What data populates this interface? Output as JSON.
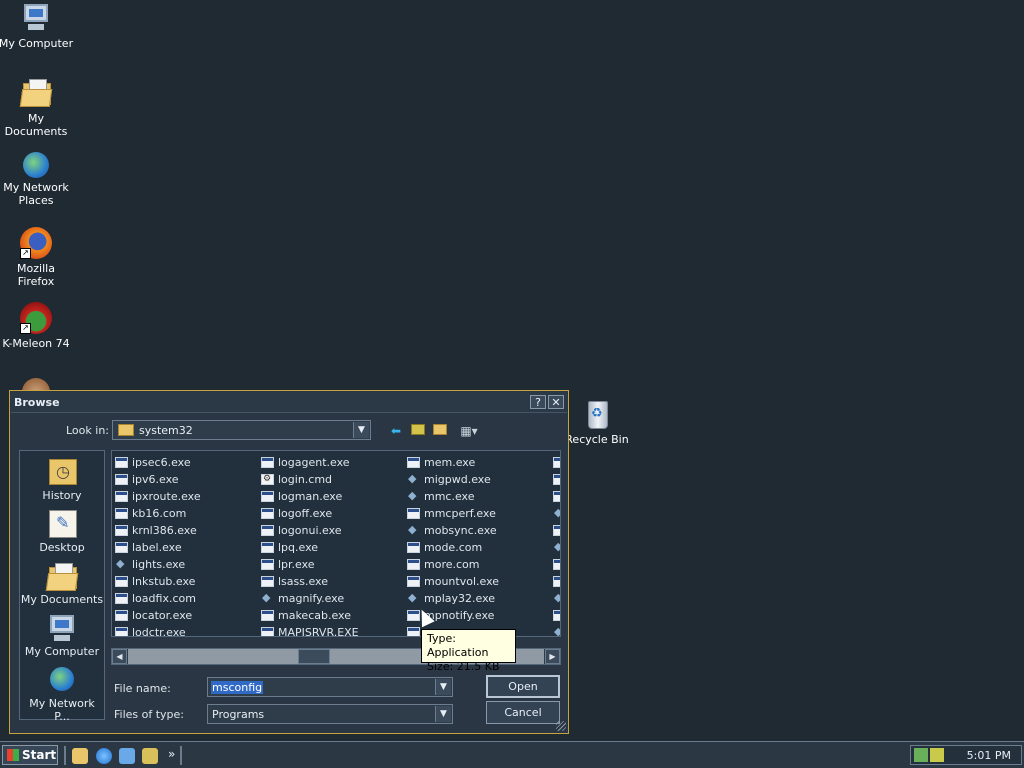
{
  "desktop": {
    "icons": [
      {
        "label": "My Computer"
      },
      {
        "label": "My Documents"
      },
      {
        "label": "My Network Places"
      },
      {
        "label": "Mozilla Firefox"
      },
      {
        "label": "K-Meleon 74"
      },
      {
        "label": "Recycle Bin"
      }
    ]
  },
  "dialog": {
    "title": "Browse",
    "help_label": "?",
    "close_label": "✕",
    "look_in_label": "Look in:",
    "look_in_value": "system32",
    "places": [
      {
        "label": "History"
      },
      {
        "label": "Desktop"
      },
      {
        "label": "My Documents"
      },
      {
        "label": "My Computer"
      },
      {
        "label": "My Network P..."
      }
    ],
    "files": {
      "col1": [
        "ipsec6.exe",
        "ipv6.exe",
        "ipxroute.exe",
        "kb16.com",
        "krnl386.exe",
        "label.exe",
        "lights.exe",
        "lnkstub.exe",
        "loadfix.com",
        "locator.exe",
        "lodctr.exe"
      ],
      "col2": [
        "logagent.exe",
        "login.cmd",
        "logman.exe",
        "logoff.exe",
        "logonui.exe",
        "lpq.exe",
        "lpr.exe",
        "lsass.exe",
        "magnify.exe",
        "makecab.exe",
        "MAPISRVR.EXE"
      ],
      "col3": [
        "mem.exe",
        "migpwd.exe",
        "mmc.exe",
        "mmcperf.exe",
        "mobsync.exe",
        "mode.com",
        "more.com",
        "mountvol.exe",
        "mplay32.exe",
        "mpnotify.exe",
        ""
      ]
    },
    "file_name_label": "File name:",
    "file_name_value": "msconfig",
    "files_of_type_label": "Files of type:",
    "files_of_type_value": "Programs",
    "open_label": "Open",
    "cancel_label": "Cancel",
    "tooltip": {
      "type": "Type: Application",
      "size": "Size: 21.5 KB"
    }
  },
  "taskbar": {
    "start_label": "Start",
    "chevron": "»",
    "clock": "5:01 PM"
  }
}
